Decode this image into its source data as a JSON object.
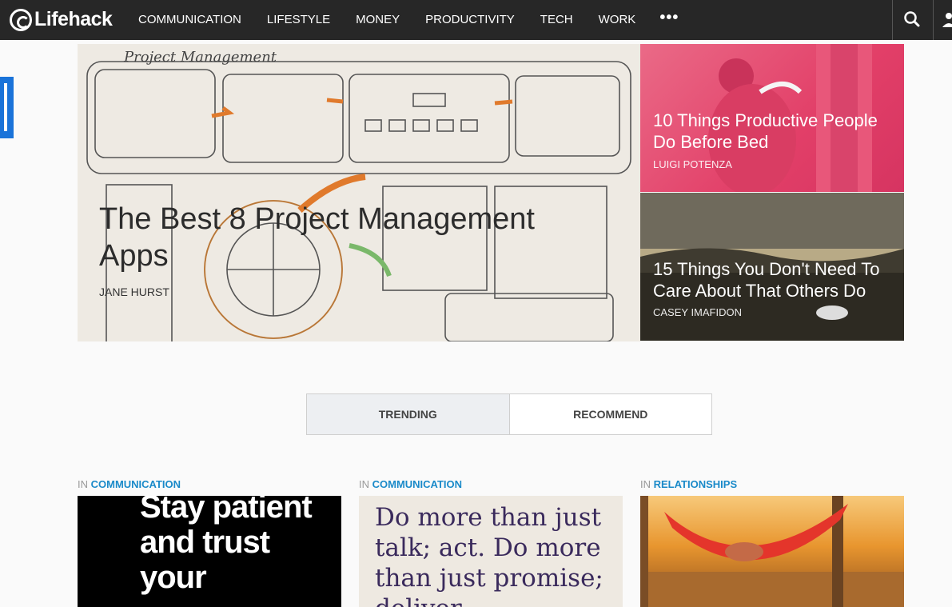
{
  "header": {
    "logo_text": "Lifehack",
    "nav": [
      "COMMUNICATION",
      "LIFESTYLE",
      "MONEY",
      "PRODUCTIVITY",
      "TECH",
      "WORK"
    ],
    "more_label": "•••",
    "icons": [
      "search-icon",
      "user-icon"
    ]
  },
  "hero": {
    "title": "The Best 8 Project Management Apps",
    "author": "JANE HURST",
    "sketch_heading": "Project Management"
  },
  "side_cards": [
    {
      "title": "10 Things Productive People Do Before Bed",
      "author": "LUIGI POTENZA"
    },
    {
      "title": "15 Things You Don't Need To Care About That Others Do",
      "author": "CASEY IMAFIDON"
    }
  ],
  "tabs": {
    "trending": "TRENDING",
    "recommend": "RECOMMEND"
  },
  "articles": [
    {
      "in": "IN",
      "category": "COMMUNICATION",
      "image_text": "Stay patient and trust your"
    },
    {
      "in": "IN",
      "category": "COMMUNICATION",
      "image_text": "Do more than just talk; act. Do more than just promise; deliver"
    },
    {
      "in": "IN",
      "category": "RELATIONSHIPS",
      "image_text": ""
    }
  ],
  "colors": {
    "topbar": "#272727",
    "accent": "#1a8ac9",
    "side_tab": "#1a73d9",
    "card1": "#e23f68"
  }
}
